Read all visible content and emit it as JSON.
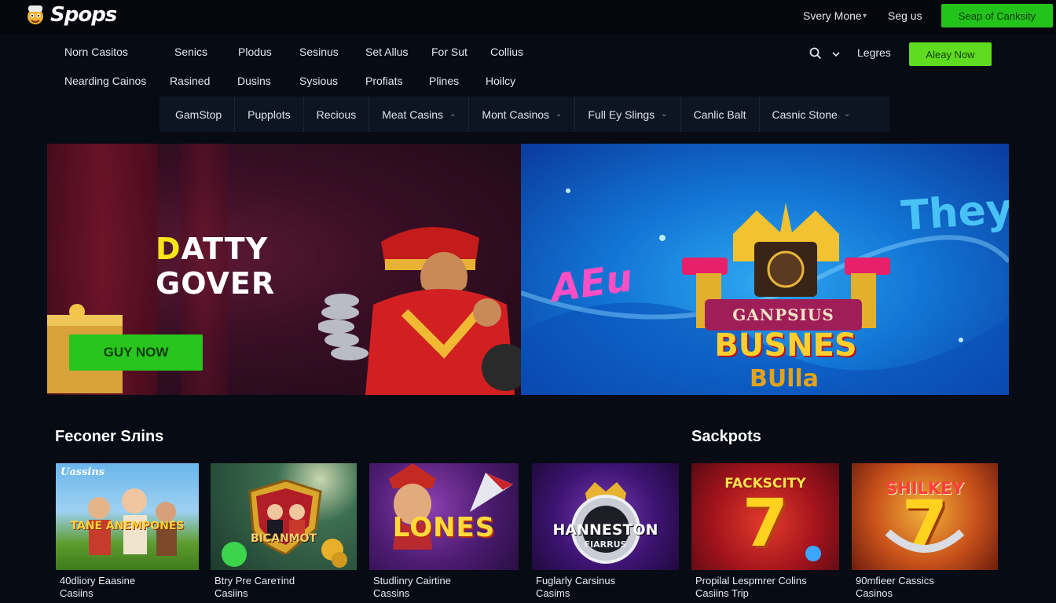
{
  "topbar": {
    "logo_text": "Spops",
    "links": [
      "Svery Mone",
      "Seg us"
    ],
    "cta_label": "Seap of Canksity"
  },
  "nav": {
    "row1": [
      "Norn Casitos",
      "Senics",
      "Plodus",
      "Sesinus",
      "Set Allus",
      "For Sut",
      "Collius"
    ],
    "row2": [
      "Nearding Cainos",
      "Rasined",
      "Dusins",
      "Sysious",
      "Profiats",
      "Plines",
      "Hoilcy"
    ],
    "lang_label": "Legres",
    "cta_label": "Aleay Now"
  },
  "subnav": {
    "items": [
      "GamStop",
      "Pupplots",
      "Recious",
      "Meat Casins",
      "Mont Casinos",
      "Full Ey Slings",
      "Canlic Balt",
      "Casnic Stone"
    ]
  },
  "hero": {
    "left": {
      "headline_line1_first": "D",
      "headline_line1_rest": "ATTY",
      "headline_line2": "GOVER",
      "button_label": "GUY NOW"
    },
    "right": {
      "they_text": "They",
      "neon_text": "AEu",
      "ribbon_text": "GANPSIUS",
      "main_text": "BUSNES",
      "sub_text": "BUlla"
    }
  },
  "sections": {
    "featured_title": "Feconer Sлins",
    "jackpots_title": "Sackpots"
  },
  "cards": [
    {
      "art": "TANE ANEMPONES",
      "corner": "Uassins",
      "label": "40dliory Eaasine\nCasiins"
    },
    {
      "art": "BICANMOT",
      "label": "Btry Pre Careтind\nCasiins"
    },
    {
      "art": "LONES",
      "label": "Studlinry Cairtine\nCassins"
    },
    {
      "art": "HANNESTON",
      "art_sub": "FIARRUS",
      "label": "Fuglarly Carsinus\nCasims"
    },
    {
      "art": "FACKSCITY",
      "art_num": "7",
      "label": "Propilal Lespmrer Colins\nCasiins  Trip"
    },
    {
      "art": "SHILKEY",
      "art_num": "7",
      "label": "90mfieer Cassics\nCasinos"
    }
  ],
  "colors": {
    "background": "#070b14",
    "primary_green": "#22c31b",
    "lime_green": "#5fdc1f",
    "subnav_bg": "#0e1522"
  }
}
